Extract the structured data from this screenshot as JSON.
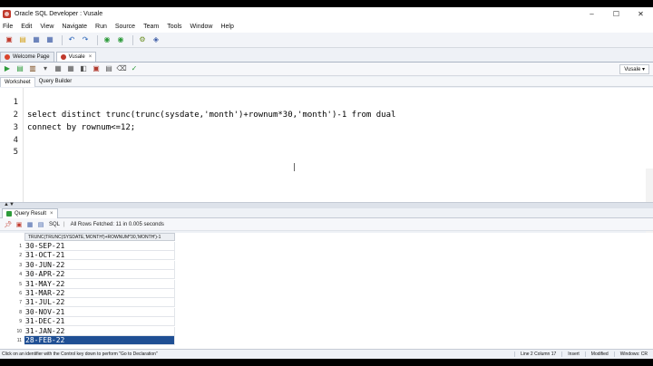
{
  "window": {
    "title": "Oracle SQL Developer : Vusale",
    "controls": [
      "–",
      "☐",
      "✕"
    ]
  },
  "menu": [
    "File",
    "Edit",
    "View",
    "Navigate",
    "Run",
    "Source",
    "Team",
    "Tools",
    "Window",
    "Help"
  ],
  "doc_tabs": [
    {
      "label": "Welcome Page",
      "color": "#d9432b"
    },
    {
      "label": "Vusale",
      "color": "#c0392b"
    }
  ],
  "connection": {
    "label": "Vusale ▾"
  },
  "subtabs": [
    "Worksheet",
    "Query Builder"
  ],
  "editor": {
    "line_numbers": [
      "1",
      "2",
      "3",
      "4",
      "5"
    ],
    "line2": {
      "p1": "select distinct trunc(trunc(sysdate,",
      "p2": "'month'",
      "p3": ")+rownum*30,",
      "p4": "'month'",
      "p5": ")-1 from dual"
    },
    "line3": "connect by rownum<=12;"
  },
  "results": {
    "tab_label": "Query Result",
    "tab_close": "×",
    "sql_label": "SQL",
    "fetch_status": "All Rows Fetched: 11 in 0.005 seconds",
    "column_header": "TRUNC(TRUNC(SYSDATE,'MONTH')+ROWNUM*30,'MONTH')-1",
    "rows": [
      {
        "n": "1",
        "v": "30-SEP-21"
      },
      {
        "n": "2",
        "v": "31-OCT-21"
      },
      {
        "n": "3",
        "v": "30-JUN-22"
      },
      {
        "n": "4",
        "v": "30-APR-22"
      },
      {
        "n": "5",
        "v": "31-MAY-22"
      },
      {
        "n": "6",
        "v": "31-MAR-22"
      },
      {
        "n": "7",
        "v": "31-JUL-22"
      },
      {
        "n": "8",
        "v": "30-NOV-21"
      },
      {
        "n": "9",
        "v": "31-DEC-21"
      },
      {
        "n": "10",
        "v": "31-JAN-22"
      },
      {
        "n": "11",
        "v": "28-FEB-22"
      }
    ],
    "selected_row": 10
  },
  "status": {
    "message": "Click on an identifier with the Control key down to perform \"Go to Declaration\"",
    "position": "Line 2 Column 17",
    "mode": "Insert",
    "state": "Modified",
    "os": "Windows: CR"
  }
}
